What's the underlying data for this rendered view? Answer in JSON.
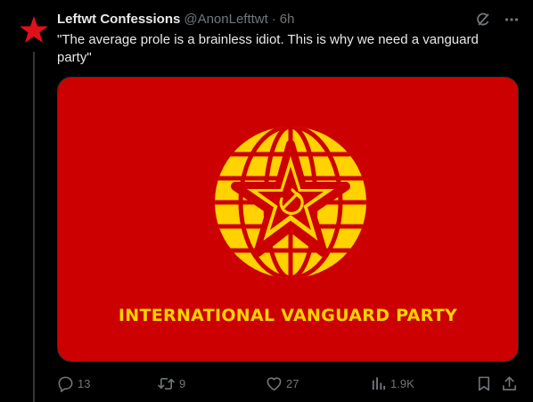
{
  "post": {
    "display_name": "Leftwt Confessions",
    "handle": "@AnonLefttwt",
    "separator": "·",
    "time": "6h",
    "text": "\"The average prole is a brainless idiot. This is why we need a vanguard party\""
  },
  "media": {
    "banner_text": "INTERNATIONAL VANGUARD PARTY",
    "colors": {
      "field": "#cc0000",
      "emblem": "#ffd200"
    }
  },
  "actions": {
    "replies": "13",
    "reposts": "9",
    "likes": "27",
    "views": "1.9K"
  },
  "icons": [
    "avatar-star-icon",
    "grok-icon",
    "more-icon",
    "reply-icon",
    "repost-icon",
    "like-icon",
    "views-icon",
    "bookmark-icon",
    "share-icon"
  ]
}
